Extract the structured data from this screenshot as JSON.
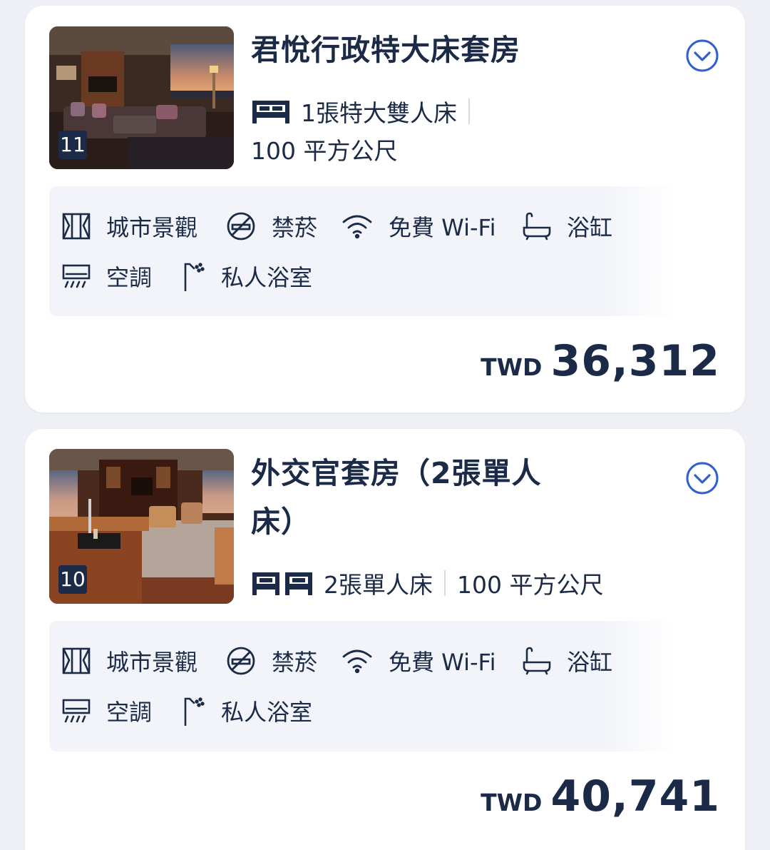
{
  "rooms": [
    {
      "title": "君悅行政特大床套房",
      "photo_count": "11",
      "bed": "1張特大雙人床",
      "size": "100 平方公尺",
      "amenities": [
        "城市景觀",
        "禁菸",
        "免費 Wi-Fi",
        "浴缸",
        "空調",
        "私人浴室"
      ],
      "currency": "TWD",
      "price": "36,312"
    },
    {
      "title": "外交官套房（2張單人床）",
      "photo_count": "10",
      "bed": "2張單人床",
      "size": "100 平方公尺",
      "amenities": [
        "城市景觀",
        "禁菸",
        "免費 Wi-Fi",
        "浴缸",
        "空調",
        "私人浴室"
      ],
      "currency": "TWD",
      "price": "40,741"
    }
  ],
  "icons": {
    "expand": "chevron-down-circle-icon",
    "bed": "bed-icon",
    "city_view": "city-view-icon",
    "no_smoking": "no-smoking-icon",
    "wifi": "wifi-icon",
    "bathtub": "bathtub-icon",
    "air_conditioning": "air-conditioner-icon",
    "private_bathroom": "shower-icon"
  },
  "colors": {
    "text": "#1b2a47",
    "accent": "#2f5fd0",
    "page_bg": "#eef0f5",
    "amenity_bg": "#f2f4f9"
  }
}
